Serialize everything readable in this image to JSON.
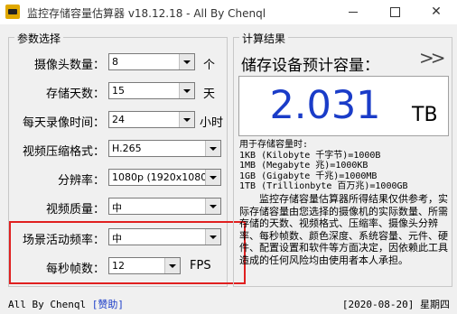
{
  "window": {
    "title": "监控存储容量估算器 v18.12.18 - All By Chenql",
    "minimize": "—",
    "maximize": "□",
    "close": "✕"
  },
  "params": {
    "legend": "参数选择",
    "camera_count": {
      "label": "摄像头数量：",
      "value": "8",
      "unit": "个"
    },
    "storage_days": {
      "label": "存储天数：",
      "value": "15",
      "unit": "天"
    },
    "daily_hours": {
      "label": "每天录像时间：",
      "value": "24",
      "unit": "小时"
    },
    "codec": {
      "label": "视频压缩格式：",
      "value": "H.265"
    },
    "resolution": {
      "label": "分辨率：",
      "value": "1080p (1920x1080"
    },
    "quality": {
      "label": "视频质量：",
      "value": "中"
    },
    "activity": {
      "label": "场景活动频率：",
      "value": "中"
    },
    "fps": {
      "label": "每秒帧数：",
      "value": "12",
      "unit": "FPS"
    }
  },
  "result": {
    "legend": "计算结果",
    "title": "储存设备预计容量：",
    "expand_icon": ">>",
    "value": "2.031",
    "unit": "TB",
    "units_heading": "用于存储容量时:",
    "units": [
      "1KB (Kilobyte 千字节)=1000B",
      "1MB (Megabyte 兆)=1000KB",
      "1GB (Gigabyte 千兆)=1000MB",
      "1TB (Trillionbyte 百万兆)=1000GB"
    ],
    "disclaimer": "监控存储容量估算器所得结果仅供参考，实际存储容量由您选择的摄像机的实际数量、所需存储的天数、视频格式、压缩率、摄像头分辨率、每秒帧数、颜色深度、系统容量、元件、硬件、配置设置和软件等方面决定，因依赖此工具造成的任何风险均由使用者本人承担。"
  },
  "status": {
    "author": "All By Chenql",
    "donate": "[赞助]",
    "date": "[2020-08-20]",
    "weekday": "星期四"
  },
  "colors": {
    "result_value": "#1a3cc8",
    "highlight": "#e02020"
  }
}
